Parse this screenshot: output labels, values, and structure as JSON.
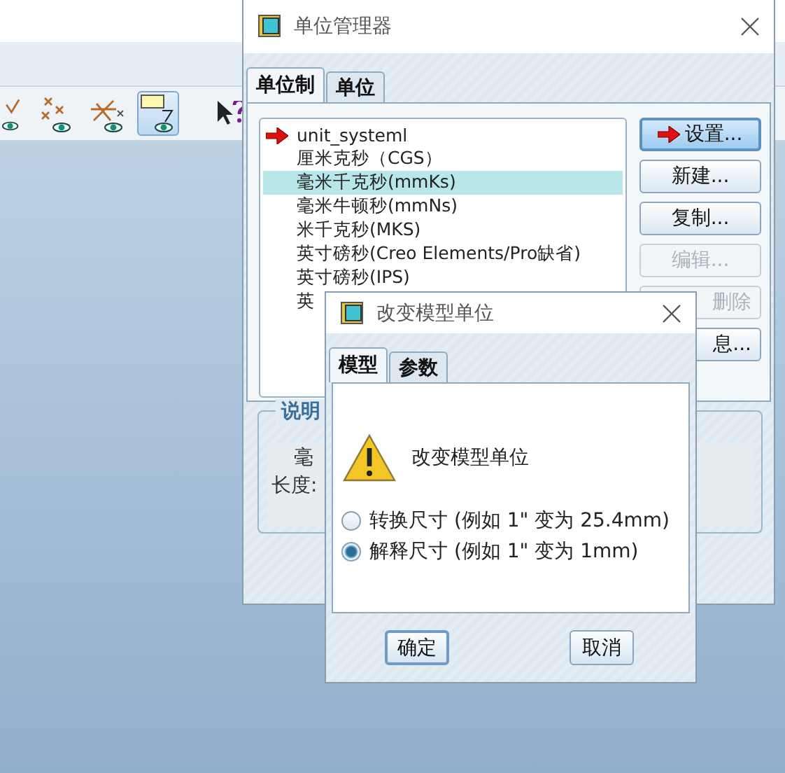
{
  "toolbar": {
    "buttons": [
      {
        "selected": false
      },
      {
        "selected": false
      },
      {
        "selected": false
      },
      {
        "selected": true
      },
      {
        "selected": false
      }
    ]
  },
  "unit_manager": {
    "title": "单位管理器",
    "tabs": [
      {
        "label": "单位制",
        "selected": true
      },
      {
        "label": "单位",
        "selected": false
      }
    ],
    "systems": [
      {
        "label": "unit_systeml",
        "selected": false,
        "current": true
      },
      {
        "label": "厘米克秒（CGS）",
        "selected": false,
        "current": false
      },
      {
        "label": "毫米千克秒(mmKs)",
        "selected": true,
        "current": false
      },
      {
        "label": "毫米牛顿秒(mmNs)",
        "selected": false,
        "current": false
      },
      {
        "label": "米千克秒(MKS)",
        "selected": false,
        "current": false
      },
      {
        "label": "英寸磅秒(Creo Elements/Pro缺省)",
        "selected": false,
        "current": false
      },
      {
        "label": "英寸磅秒(IPS)",
        "selected": false,
        "current": false
      },
      {
        "label": "英",
        "selected": false,
        "current": false
      }
    ],
    "buttons": [
      {
        "label": "设置...",
        "disabled": false,
        "default": true
      },
      {
        "label": "新建...",
        "disabled": false,
        "default": false
      },
      {
        "label": "复制...",
        "disabled": false,
        "default": false
      },
      {
        "label": "编辑...",
        "disabled": true,
        "default": false
      },
      {
        "label": "删除",
        "disabled": true,
        "default": false
      },
      {
        "label": "息...",
        "disabled": false,
        "default": false
      }
    ],
    "description": {
      "title": "说明",
      "lines": [
        "毫",
        "长度:"
      ]
    }
  },
  "change_units": {
    "title": "改变模型单位",
    "tabs": [
      {
        "label": "模型",
        "selected": true
      },
      {
        "label": "参数",
        "selected": false
      }
    ],
    "message": "改变模型单位",
    "options": [
      {
        "label": "转换尺寸 (例如 1\" 变为 25.4mm)",
        "selected": false
      },
      {
        "label": "解释尺寸 (例如 1\" 变为 1mm)",
        "selected": true
      }
    ],
    "buttons": [
      {
        "label": "确定",
        "default": true
      },
      {
        "label": "取消",
        "default": false
      }
    ]
  }
}
